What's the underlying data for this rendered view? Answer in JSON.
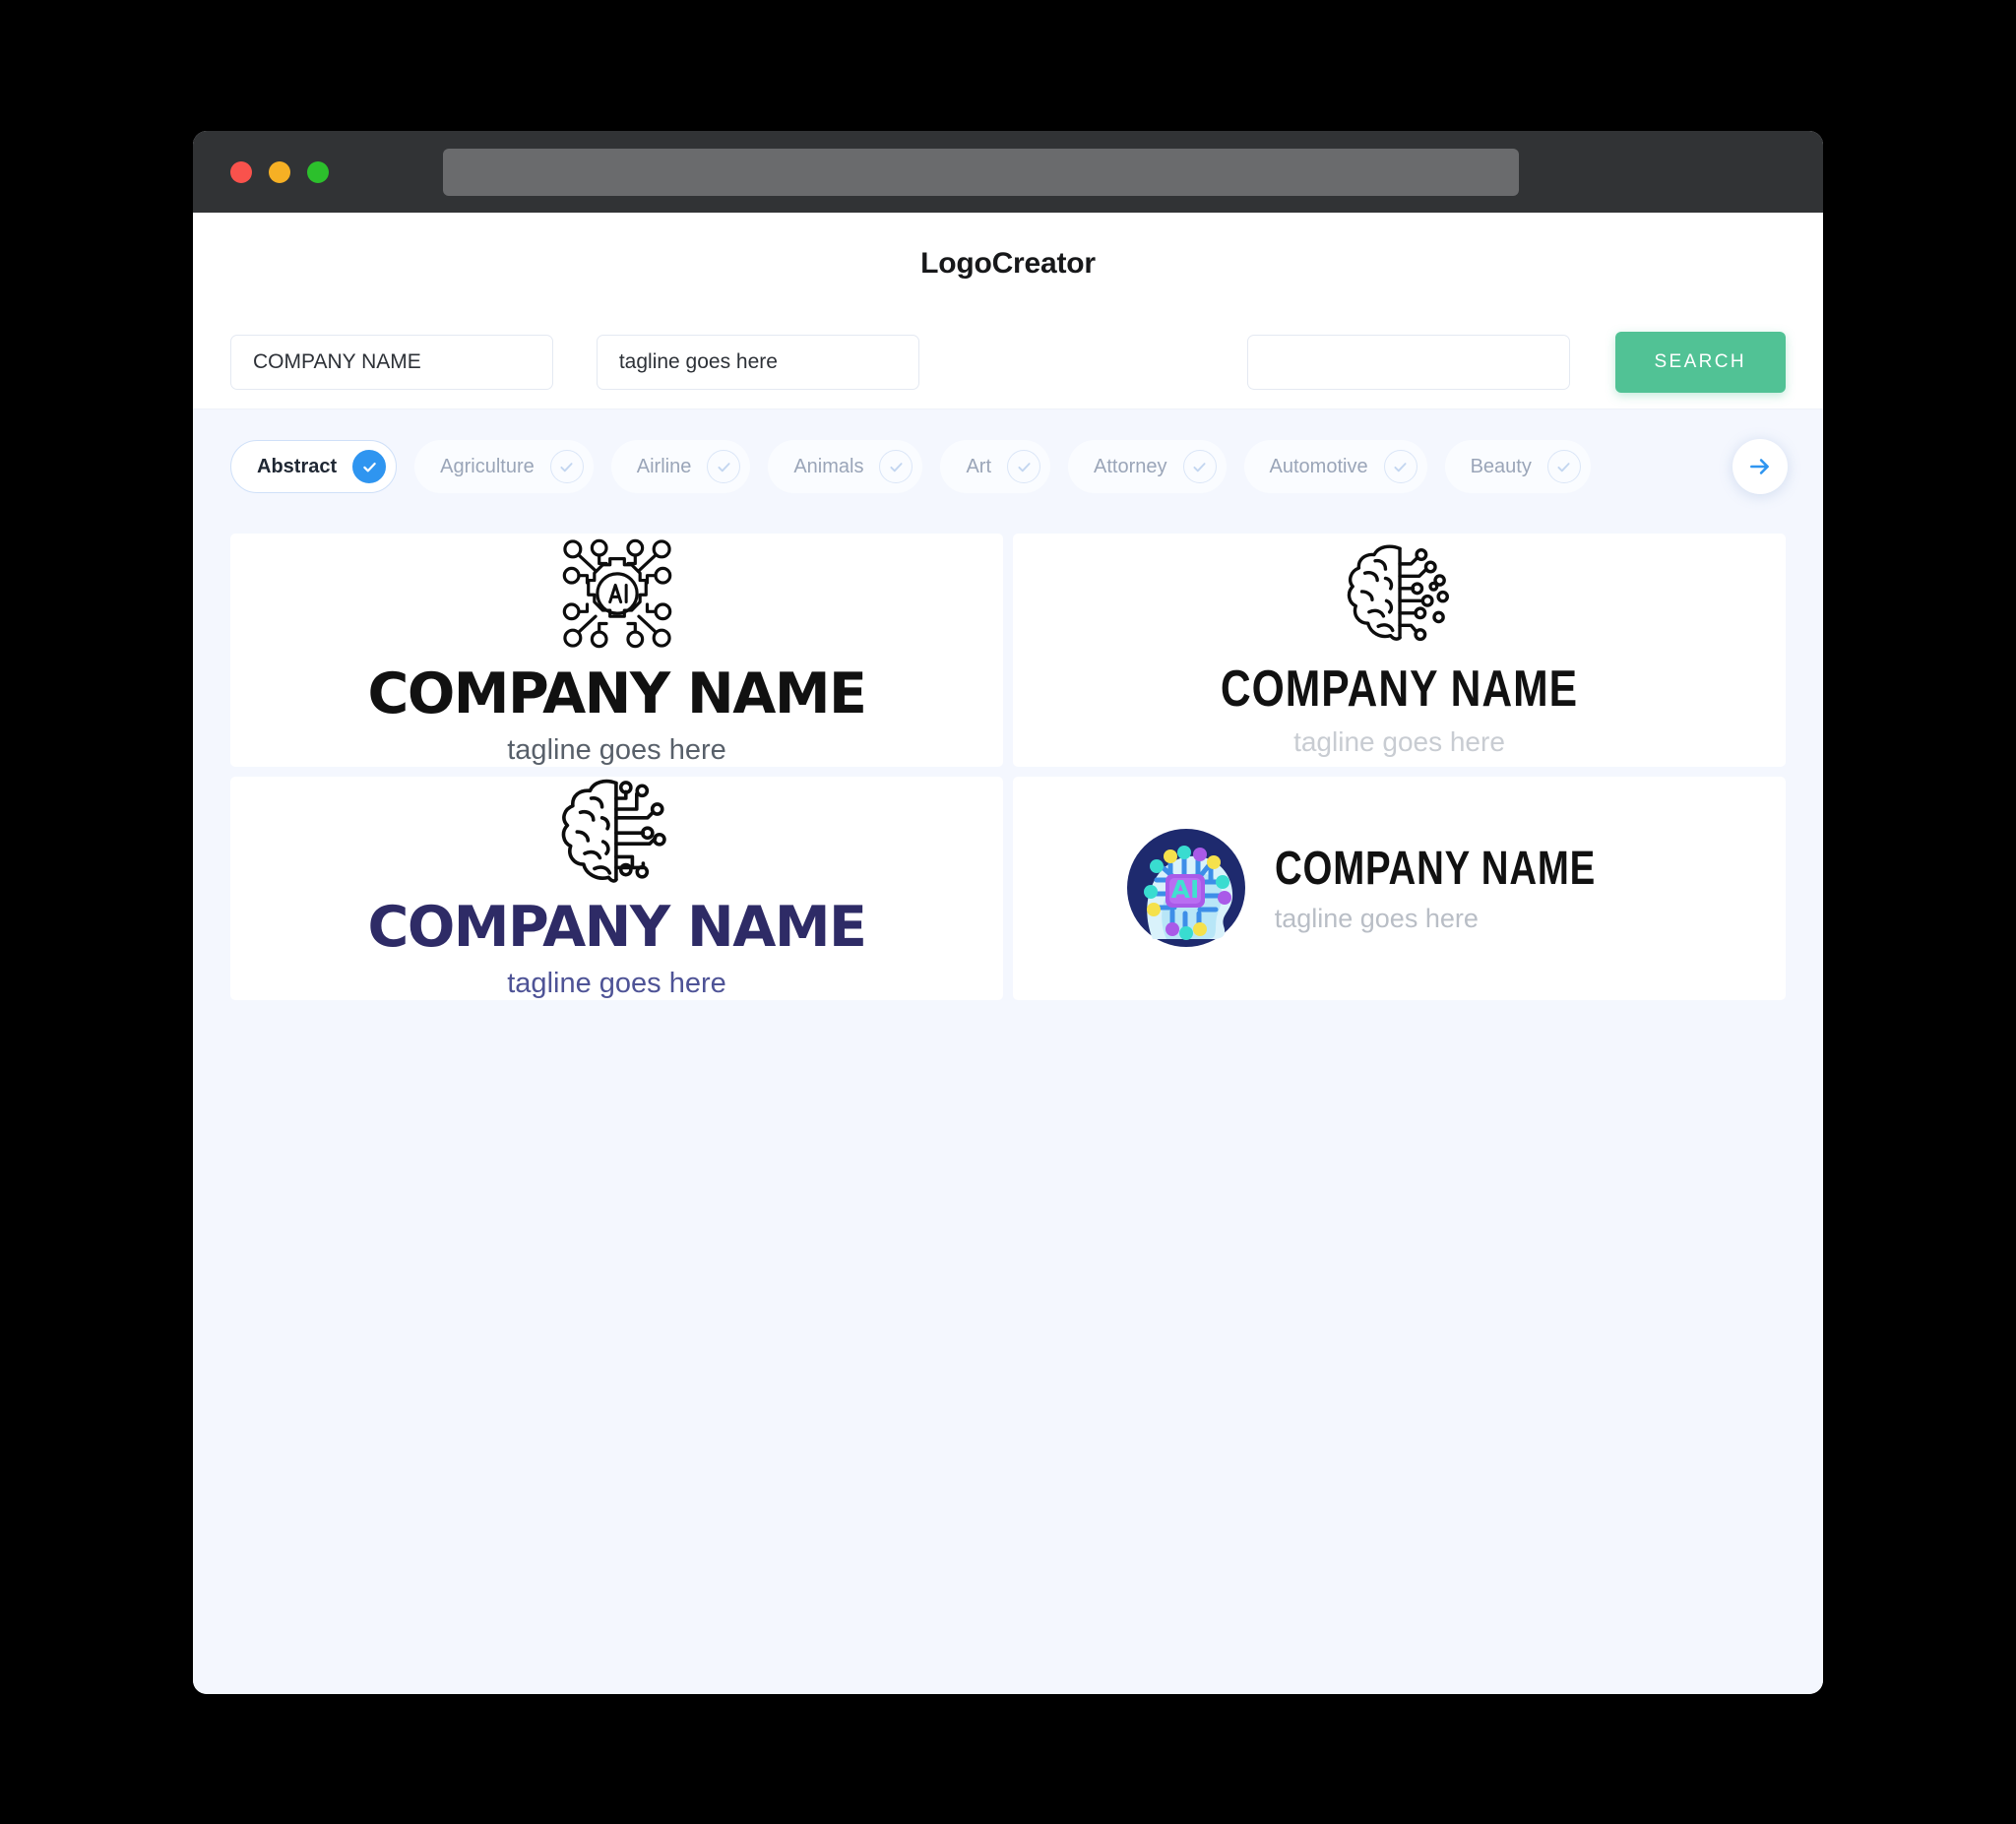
{
  "window": {
    "traffic_lights": [
      "close",
      "minimize",
      "maximize"
    ],
    "url_value": "",
    "chrome_color": "#313335",
    "urlbar_color": "#6a6b6d"
  },
  "header": {
    "title": "LogoCreator"
  },
  "search": {
    "company_value": "COMPANY NAME",
    "company_placeholder": "COMPANY NAME",
    "tagline_value": "tagline goes here",
    "tagline_placeholder": "tagline goes here",
    "keyword_value": "",
    "keyword_placeholder": "",
    "button_label": "SEARCH",
    "button_color": "#51c295"
  },
  "categories": {
    "accent_color": "#2f95f0",
    "next_label": "next",
    "items": [
      {
        "label": "Abstract",
        "selected": true
      },
      {
        "label": "Agriculture",
        "selected": false
      },
      {
        "label": "Airline",
        "selected": false
      },
      {
        "label": "Animals",
        "selected": false
      },
      {
        "label": "Art",
        "selected": false
      },
      {
        "label": "Attorney",
        "selected": false
      },
      {
        "label": "Automotive",
        "selected": false
      },
      {
        "label": "Beauty",
        "selected": false
      }
    ]
  },
  "results": {
    "cards": [
      {
        "icon": "ai-gear-network-icon",
        "name": "COMPANY NAME",
        "tagline": "tagline goes here",
        "name_color": "#111111",
        "tagline_color": "#58606a",
        "layout": "stacked"
      },
      {
        "icon": "brain-circuit-icon",
        "name": "COMPANY NAME",
        "tagline": "tagline goes here",
        "name_color": "#111111",
        "tagline_color": "#c8ccd2",
        "layout": "stacked"
      },
      {
        "icon": "brain-circuit-icon",
        "name": "COMPANY NAME",
        "tagline": "tagline goes here",
        "name_color": "#2e2b66",
        "tagline_color": "#4e5396",
        "layout": "stacked"
      },
      {
        "icon": "ai-head-chip-icon",
        "name": "COMPANY NAME",
        "tagline": "tagline goes here",
        "name_color": "#111111",
        "tagline_color": "#b9bec6",
        "layout": "horizontal"
      }
    ]
  }
}
